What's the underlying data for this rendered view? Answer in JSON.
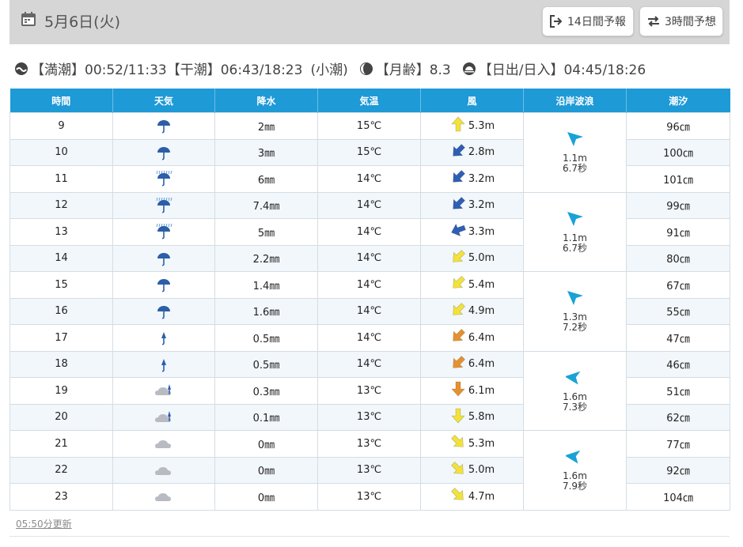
{
  "header": {
    "date": "5月6日(火)",
    "btn_14day": "14日間予報",
    "btn_3hour": "3時間予想"
  },
  "info": {
    "high_tide": "【満潮】00:52/11:33",
    "low_tide": "【干潮】06:43/18:23",
    "tide_type": "(小潮)",
    "moon_age": "【月齢】8.3",
    "sun": "【日出/日入】04:45/18:26"
  },
  "table": {
    "headers": [
      "時間",
      "天気",
      "降水",
      "気温",
      "風",
      "沿岸波浪",
      "潮汐"
    ],
    "rows": [
      {
        "hour": "9",
        "weather": "umbrella",
        "precip": "2㎜",
        "temp": "15℃",
        "wind_dir": "S",
        "wind_color": "#f2e23a",
        "wind": "5.3m",
        "tide": "96㎝"
      },
      {
        "hour": "10",
        "weather": "umbrella",
        "precip": "3㎜",
        "temp": "15℃",
        "wind_dir": "NE",
        "wind_color": "#2f5fb5",
        "wind": "2.8m",
        "tide": "100㎝"
      },
      {
        "hour": "11",
        "weather": "umbrella-heavy",
        "precip": "6㎜",
        "temp": "14℃",
        "wind_dir": "NE",
        "wind_color": "#2f5fb5",
        "wind": "3.2m",
        "tide": "101㎝"
      },
      {
        "hour": "12",
        "weather": "umbrella-heavy",
        "precip": "7.4㎜",
        "temp": "14℃",
        "wind_dir": "NE",
        "wind_color": "#2f5fb5",
        "wind": "3.2m",
        "tide": "99㎝"
      },
      {
        "hour": "13",
        "weather": "umbrella-heavy",
        "precip": "5㎜",
        "temp": "14℃",
        "wind_dir": "ENE",
        "wind_color": "#2f5fb5",
        "wind": "3.3m",
        "tide": "91㎝"
      },
      {
        "hour": "14",
        "weather": "umbrella",
        "precip": "2.2㎜",
        "temp": "14℃",
        "wind_dir": "NE",
        "wind_color": "#f2e23a",
        "wind": "5.0m",
        "tide": "80㎝"
      },
      {
        "hour": "15",
        "weather": "umbrella",
        "precip": "1.4㎜",
        "temp": "14℃",
        "wind_dir": "NE",
        "wind_color": "#f2e23a",
        "wind": "5.4m",
        "tide": "67㎝"
      },
      {
        "hour": "16",
        "weather": "umbrella",
        "precip": "1.6㎜",
        "temp": "14℃",
        "wind_dir": "NE",
        "wind_color": "#f2e23a",
        "wind": "4.9m",
        "tide": "55㎝"
      },
      {
        "hour": "17",
        "weather": "umbrella-small",
        "precip": "0.5㎜",
        "temp": "14℃",
        "wind_dir": "NE",
        "wind_color": "#e7912e",
        "wind": "6.4m",
        "tide": "47㎝"
      },
      {
        "hour": "18",
        "weather": "umbrella-small",
        "precip": "0.5㎜",
        "temp": "14℃",
        "wind_dir": "NE",
        "wind_color": "#e7912e",
        "wind": "6.4m",
        "tide": "46㎝"
      },
      {
        "hour": "19",
        "weather": "cloud-rain",
        "precip": "0.3㎜",
        "temp": "13℃",
        "wind_dir": "N",
        "wind_color": "#e7912e",
        "wind": "6.1m",
        "tide": "51㎝"
      },
      {
        "hour": "20",
        "weather": "cloud-rain",
        "precip": "0.1㎜",
        "temp": "13℃",
        "wind_dir": "N",
        "wind_color": "#f2e23a",
        "wind": "5.8m",
        "tide": "62㎝"
      },
      {
        "hour": "21",
        "weather": "cloud",
        "precip": "0㎜",
        "temp": "13℃",
        "wind_dir": "NW",
        "wind_color": "#f2e23a",
        "wind": "5.3m",
        "tide": "77㎝"
      },
      {
        "hour": "22",
        "weather": "cloud",
        "precip": "0㎜",
        "temp": "13℃",
        "wind_dir": "NW",
        "wind_color": "#f2e23a",
        "wind": "5.0m",
        "tide": "92㎝"
      },
      {
        "hour": "23",
        "weather": "cloud",
        "precip": "0㎜",
        "temp": "13℃",
        "wind_dir": "NW",
        "wind_color": "#f2e23a",
        "wind": "4.7m",
        "tide": "104㎝"
      }
    ],
    "waves": [
      {
        "height": "1.1m",
        "period": "6.7秒",
        "dir": "NW"
      },
      {
        "height": "1.1m",
        "period": "6.7秒",
        "dir": "NW"
      },
      {
        "height": "1.3m",
        "period": "7.2秒",
        "dir": "NW"
      },
      {
        "height": "1.6m",
        "period": "7.3秒",
        "dir": "W"
      },
      {
        "height": "1.6m",
        "period": "7.9秒",
        "dir": "W"
      }
    ]
  },
  "footer": {
    "updated": "05:50分更新"
  }
}
